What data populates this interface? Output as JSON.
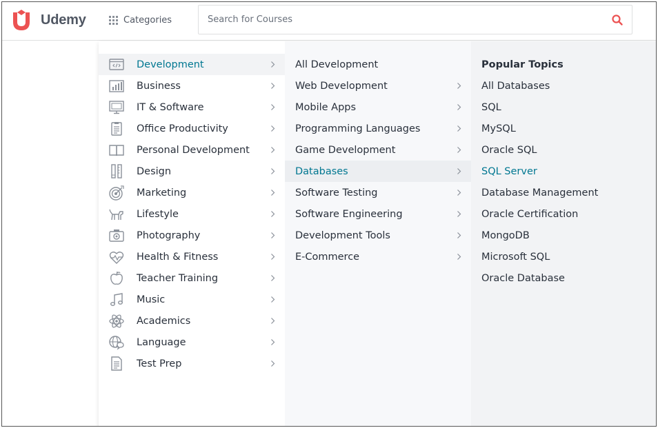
{
  "header": {
    "logo_text": "Udemy",
    "categories_label": "Categories",
    "search_placeholder": "Search for Courses"
  },
  "colors": {
    "brand": "#ec5252",
    "accent_teal": "#007791",
    "text": "#29303b",
    "icon_gray": "#8a9099"
  },
  "categories": [
    {
      "label": "Development",
      "icon": "code-window-icon",
      "active": true
    },
    {
      "label": "Business",
      "icon": "bar-chart-icon"
    },
    {
      "label": "IT & Software",
      "icon": "monitor-icon"
    },
    {
      "label": "Office Productivity",
      "icon": "clipboard-icon"
    },
    {
      "label": "Personal Development",
      "icon": "book-icon"
    },
    {
      "label": "Design",
      "icon": "pencil-ruler-icon"
    },
    {
      "label": "Marketing",
      "icon": "target-icon"
    },
    {
      "label": "Lifestyle",
      "icon": "dog-icon"
    },
    {
      "label": "Photography",
      "icon": "camera-icon"
    },
    {
      "label": "Health & Fitness",
      "icon": "heart-pulse-icon"
    },
    {
      "label": "Teacher Training",
      "icon": "apple-icon"
    },
    {
      "label": "Music",
      "icon": "music-note-icon"
    },
    {
      "label": "Academics",
      "icon": "atom-icon"
    },
    {
      "label": "Language",
      "icon": "globe-chat-icon"
    },
    {
      "label": "Test Prep",
      "icon": "document-icon"
    }
  ],
  "subcategories": [
    {
      "label": "All Development",
      "chevron": false
    },
    {
      "label": "Web Development",
      "chevron": true
    },
    {
      "label": "Mobile Apps",
      "chevron": true
    },
    {
      "label": "Programming Languages",
      "chevron": true
    },
    {
      "label": "Game Development",
      "chevron": true
    },
    {
      "label": "Databases",
      "chevron": true,
      "active": true
    },
    {
      "label": "Software Testing",
      "chevron": true
    },
    {
      "label": "Software Engineering",
      "chevron": true
    },
    {
      "label": "Development Tools",
      "chevron": true
    },
    {
      "label": "E-Commerce",
      "chevron": true
    }
  ],
  "topics": {
    "title": "Popular Topics",
    "items": [
      {
        "label": "All Databases"
      },
      {
        "label": "SQL"
      },
      {
        "label": "MySQL"
      },
      {
        "label": "Oracle SQL"
      },
      {
        "label": "SQL Server",
        "highlight": true
      },
      {
        "label": "Database Management"
      },
      {
        "label": "Oracle Certification"
      },
      {
        "label": "MongoDB"
      },
      {
        "label": "Microsoft SQL"
      },
      {
        "label": "Oracle Database"
      }
    ]
  }
}
